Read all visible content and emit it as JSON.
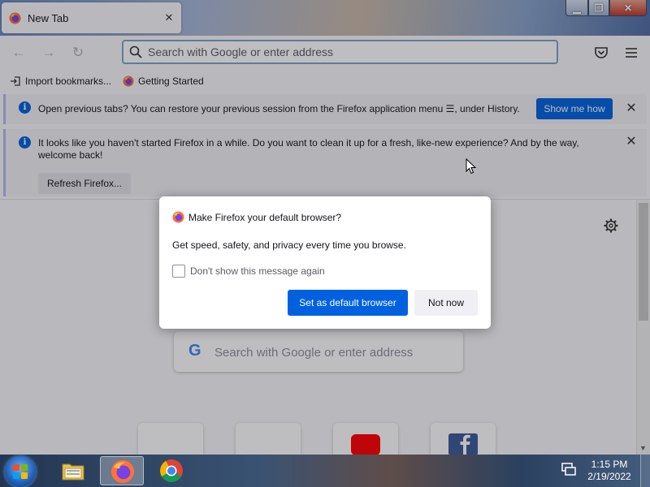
{
  "browser": {
    "tab": {
      "title": "New Tab"
    },
    "urlbar": {
      "placeholder": "Search with Google or enter address"
    },
    "bookmarks": [
      {
        "label": "Import bookmarks...",
        "icon": "import-icon"
      },
      {
        "label": "Getting Started",
        "icon": "firefox-icon"
      }
    ]
  },
  "notifications": {
    "restore": {
      "message": "Open previous tabs? You can restore your previous session from the Firefox application menu ☰, under History.",
      "button": "Show me how"
    },
    "refresh": {
      "message_line1": "It looks like you haven't started Firefox in a while. Do you want to clean it up for a fresh, like-new experience? And by the way,",
      "message_line2": "welcome back!",
      "button": "Refresh Firefox..."
    }
  },
  "content": {
    "search_placeholder": "Search with Google or enter address",
    "google_letter": "G"
  },
  "modal": {
    "title": "Make Firefox your default browser?",
    "body": "Get speed, safety, and privacy every time you browse.",
    "checkbox_label": "Don't show this message again",
    "primary_button": "Set as default browser",
    "secondary_button": "Not now"
  },
  "taskbar": {
    "clock_time": "1:15 PM",
    "clock_date": "2/19/2022"
  },
  "colors": {
    "accent_blue": "#0061e0",
    "info_blue": "#0060df",
    "firefox_orange": "#ff7139"
  }
}
